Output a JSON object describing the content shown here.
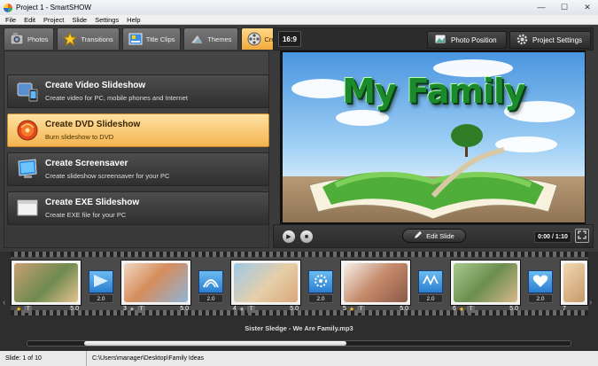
{
  "window": {
    "title": "Project 1 - SmartSHOW",
    "minimize": "—",
    "maximize": "☐",
    "close": "✕"
  },
  "menu": [
    {
      "label": "File"
    },
    {
      "label": "Edit"
    },
    {
      "label": "Project"
    },
    {
      "label": "Slide"
    },
    {
      "label": "Settings"
    },
    {
      "label": "Help"
    }
  ],
  "tabs": [
    {
      "label": "Photos"
    },
    {
      "label": "Transitions"
    },
    {
      "label": "Title Clips"
    },
    {
      "label": "Themes"
    },
    {
      "label": "Create",
      "active": true
    }
  ],
  "actions": [
    {
      "title": "Create Video Slideshow",
      "desc": "Create video for PC, mobile phones and Internet"
    },
    {
      "title": "Create DVD Slideshow",
      "desc": "Burn slideshow to DVD",
      "selected": true
    },
    {
      "title": "Create Screensaver",
      "desc": "Create slideshow screensaver for your PC"
    },
    {
      "title": "Create EXE Slideshow",
      "desc": "Create EXE file for your PC"
    }
  ],
  "toolbar": {
    "ratio": "16:9",
    "photo_position": "Photo Position",
    "project_settings": "Project Settings"
  },
  "preview": {
    "title_text": "My Family"
  },
  "controls": {
    "edit_slide": "Edit Slide",
    "time": "0:00 / 1:10"
  },
  "slides": [
    {
      "num": "",
      "duration": "5.0"
    },
    {
      "num": "3",
      "duration": "5.0"
    },
    {
      "num": "4",
      "duration": "5.0"
    },
    {
      "num": "5",
      "duration": "5.0"
    },
    {
      "num": "6",
      "duration": "5.0"
    },
    {
      "num": "7",
      "duration": ""
    }
  ],
  "transitions": [
    {
      "duration": "2.0"
    },
    {
      "duration": "2.0"
    },
    {
      "duration": "2.0"
    },
    {
      "duration": "2.0"
    },
    {
      "duration": "2.0"
    }
  ],
  "music": "Sister Sledge - We Are Family.mp3",
  "status": {
    "slide": "Slide: 1 of 10",
    "path": "C:\\Users\\manager\\Desktop\\Family Ideas"
  }
}
